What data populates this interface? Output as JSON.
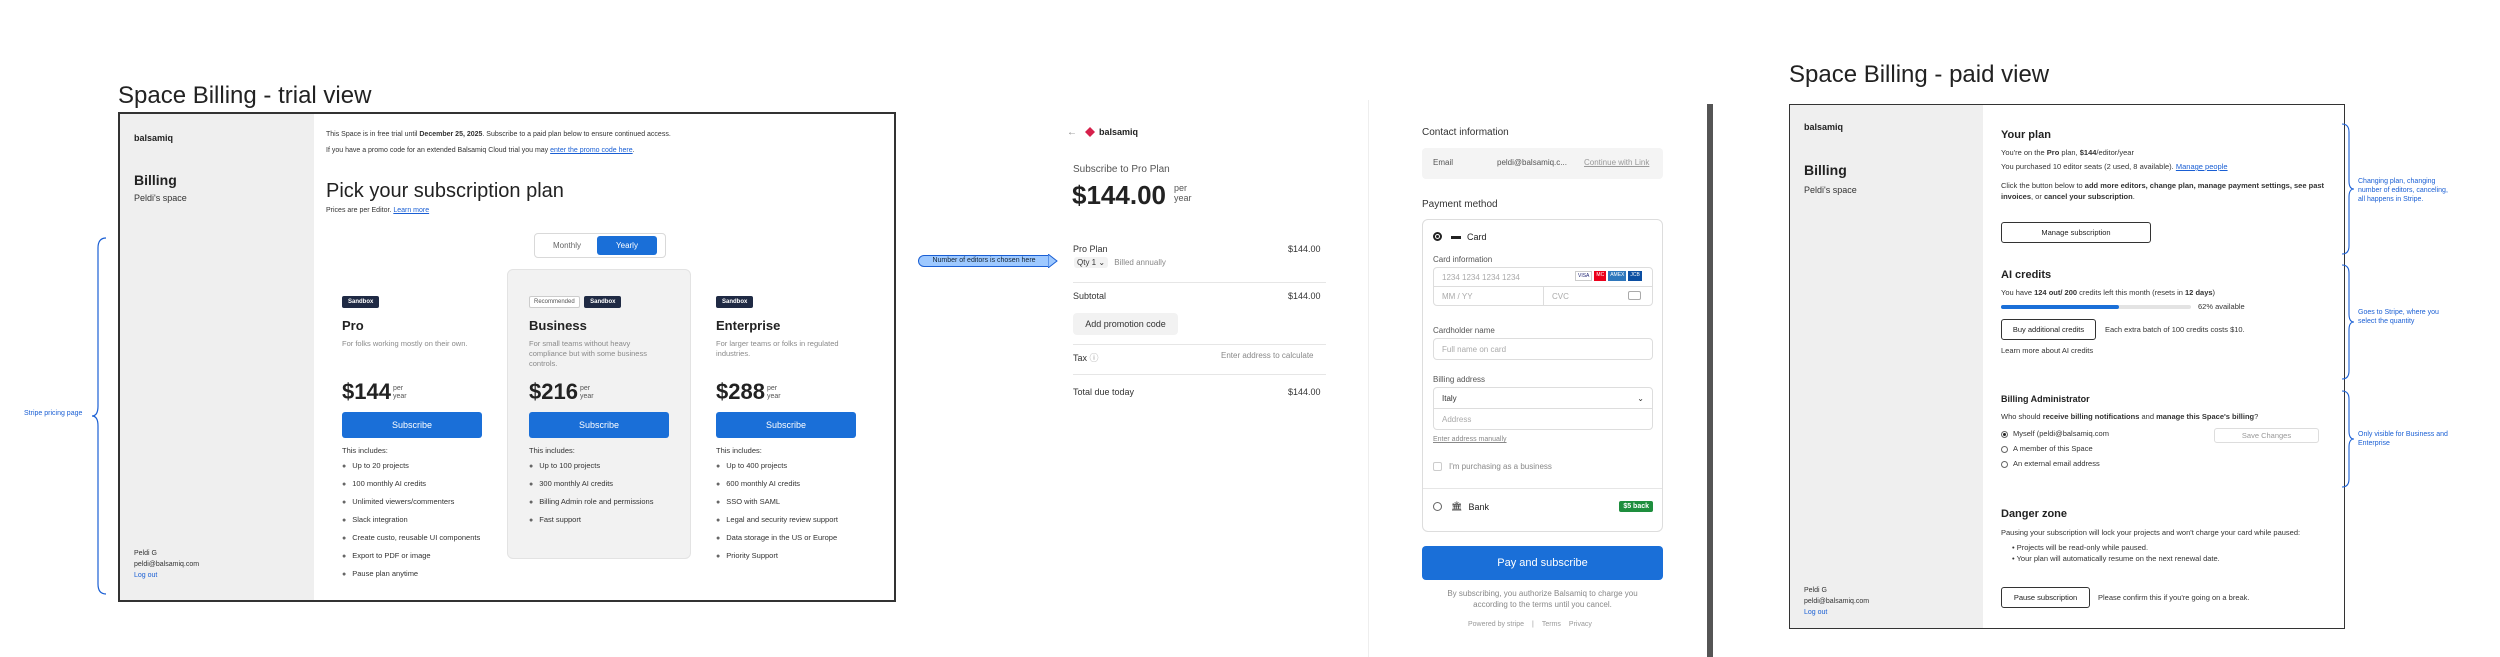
{
  "trial": {
    "section_title": "Space Billing - trial view",
    "logo": "balsamiq",
    "sidebar_title": "Billing",
    "sidebar_space": "Peldi's space",
    "user_name": "Peldi G",
    "user_email": "peldi@balsamiq.com",
    "logout": "Log out",
    "notice_line1_pre": "This Space is in free trial until ",
    "notice_date": "December 25, 2025",
    "notice_line1_post": ". Subscribe to a paid plan below to ensure continued access.",
    "notice_line2_pre": "If you have a promo code for an extended Balsamiq Cloud trial you may ",
    "notice_link": "enter the promo code here",
    "notice_line2_post": ".",
    "heading": "Pick your subscription plan",
    "prices_note": "Prices are per Editor.",
    "learn_more": "Learn more",
    "toggle_monthly": "Monthly",
    "toggle_yearly": "Yearly",
    "recommended": "Recommended",
    "sandbox": "Sandbox",
    "includes": "This includes:",
    "subscribe": "Subscribe",
    "per_line1": "per",
    "per_line2": "year",
    "brace_label": "Stripe pricing page",
    "plans": [
      {
        "name": "Pro",
        "desc": "For folks working mostly on their own.",
        "price": "$144",
        "features": [
          "Up to 20 projects",
          "100 monthly AI credits",
          "Unlimited viewers/commenters",
          "Slack integration",
          "Create custo, reusable UI components",
          "Export to PDF or image",
          "Pause plan anytime"
        ]
      },
      {
        "name": "Business",
        "desc": "For small teams without heavy compliance but with some business controls.",
        "price": "$216",
        "features": [
          "Up to 100 projects",
          "300 monthly AI credits",
          "Billing Admin role and permissions",
          "Fast support"
        ]
      },
      {
        "name": "Enterprise",
        "desc": "For larger teams or folks in regulated industries.",
        "price": "$288",
        "features": [
          "Up to 400 projects",
          "600 monthly AI credits",
          "SSO with SAML",
          "Legal and security review support",
          "Data storage in the US or Europe",
          "Priority Support"
        ]
      }
    ]
  },
  "checkout": {
    "back_arrow": "←",
    "logo": "balsamiq",
    "subscribe_to": "Subscribe to Pro Plan",
    "amount": "$144.00",
    "per": "per",
    "year": "year",
    "callout": "Number of editors is chosen here",
    "plan_name": "Pro Plan",
    "plan_amount": "$144.00",
    "qty": "Qty 1",
    "billed": "Billed annually",
    "subtotal_label": "Subtotal",
    "subtotal": "$144.00",
    "promo": "Add promotion code",
    "tax_label": "Tax",
    "tax_value": "Enter address to calculate",
    "total_label": "Total due today",
    "total": "$144.00",
    "contact_title": "Contact information",
    "email_label": "Email",
    "email_value": "peldi@balsamiq.c...",
    "continue_link": "Continue with Link",
    "payment_title": "Payment method",
    "card_label": "Card",
    "card_info": "Card information",
    "card_number_ph": "1234 1234 1234 1234",
    "expiry_ph": "MM / YY",
    "cvc_ph": "CVC",
    "cardholder_label": "Cardholder name",
    "cardholder_ph": "Full name on card",
    "billing_label": "Billing address",
    "country": "Italy",
    "address_ph": "Address",
    "manual_link": "Enter address manually",
    "business_check": "I'm purchasing as a business",
    "bank_label": "Bank",
    "cashback": "$5 back",
    "pay_btn": "Pay and subscribe",
    "legal": "By subscribing, you authorize Balsamiq to charge you according to the terms until you cancel.",
    "powered": "Powered by stripe",
    "terms": "Terms",
    "privacy": "Privacy",
    "card_brands": [
      "VISA",
      "MC",
      "AMEX",
      "JCB"
    ]
  },
  "paid": {
    "section_title": "Space Billing - paid view",
    "logo": "balsamiq",
    "sidebar_title": "Billing",
    "sidebar_space": "Peldi's space",
    "user_name": "Peldi G",
    "user_email": "peldi@balsamiq.com",
    "logout": "Log out",
    "your_plan_title": "Your plan",
    "plan_line_pre": "You're on the ",
    "plan_line_bold": "Pro",
    "plan_line_mid": " plan, ",
    "plan_line_price": "$144",
    "plan_line_post": "/editor/year",
    "seats_line": "You purchased 10 editor seats (2 used, 8 available).",
    "manage_people": "Manage people",
    "click_pre": "Click the button below to ",
    "click_bold1": "add more editors, change plan, manage payment settings, see past invoices",
    "click_mid": ", or ",
    "click_bold2": "cancel your subscription",
    "click_post": ".",
    "manage_btn": "Manage subscription",
    "ai_title": "AI credits",
    "ai_line_pre": "You have ",
    "ai_line_bold": "124 out/ 200",
    "ai_line_mid": " credits left this month (resets in ",
    "ai_line_days": "12 days",
    "ai_line_post": ")",
    "ai_available": "62% available",
    "ai_fraction": 0.62,
    "buy_btn": "Buy additional credits",
    "buy_note": "Each extra batch of 100 credits costs $10.",
    "learn_ai": "Learn more about AI credits",
    "admin_title": "Billing Administrator",
    "admin_q_pre": "Who should ",
    "admin_q_bold1": "receive billing notifications",
    "admin_q_mid": " and ",
    "admin_q_bold2": "manage this Space's billing",
    "admin_q_post": "?",
    "admin_opt1": "Myself (peldi@balsamiq.com",
    "admin_opt2": "A member of this Space",
    "admin_opt3": "An external email address",
    "save_changes": "Save Changes",
    "danger_title": "Danger zone",
    "danger_text": "Pausing your subscription will lock your projects and won't charge your card while paused:",
    "danger_b1": "Projects will be read-only while paused.",
    "danger_b2": "Your plan will automatically resume on the next renewal date.",
    "pause_btn": "Pause subscription",
    "pause_note": "Please confirm this if you're going on a break.",
    "anno1": "Changing plan, changing number of editors, canceling, all happens in Stripe.",
    "anno2": "Goes to Stripe, where you select the quantity",
    "anno3": "Only visible for Business and Enterprise"
  },
  "colors": {
    "accent": "#1a6fd8",
    "link": "#1a5fd4",
    "annotation": "#1a5fd4",
    "sidebar": "#efefef",
    "success": "#1e8e3e"
  }
}
